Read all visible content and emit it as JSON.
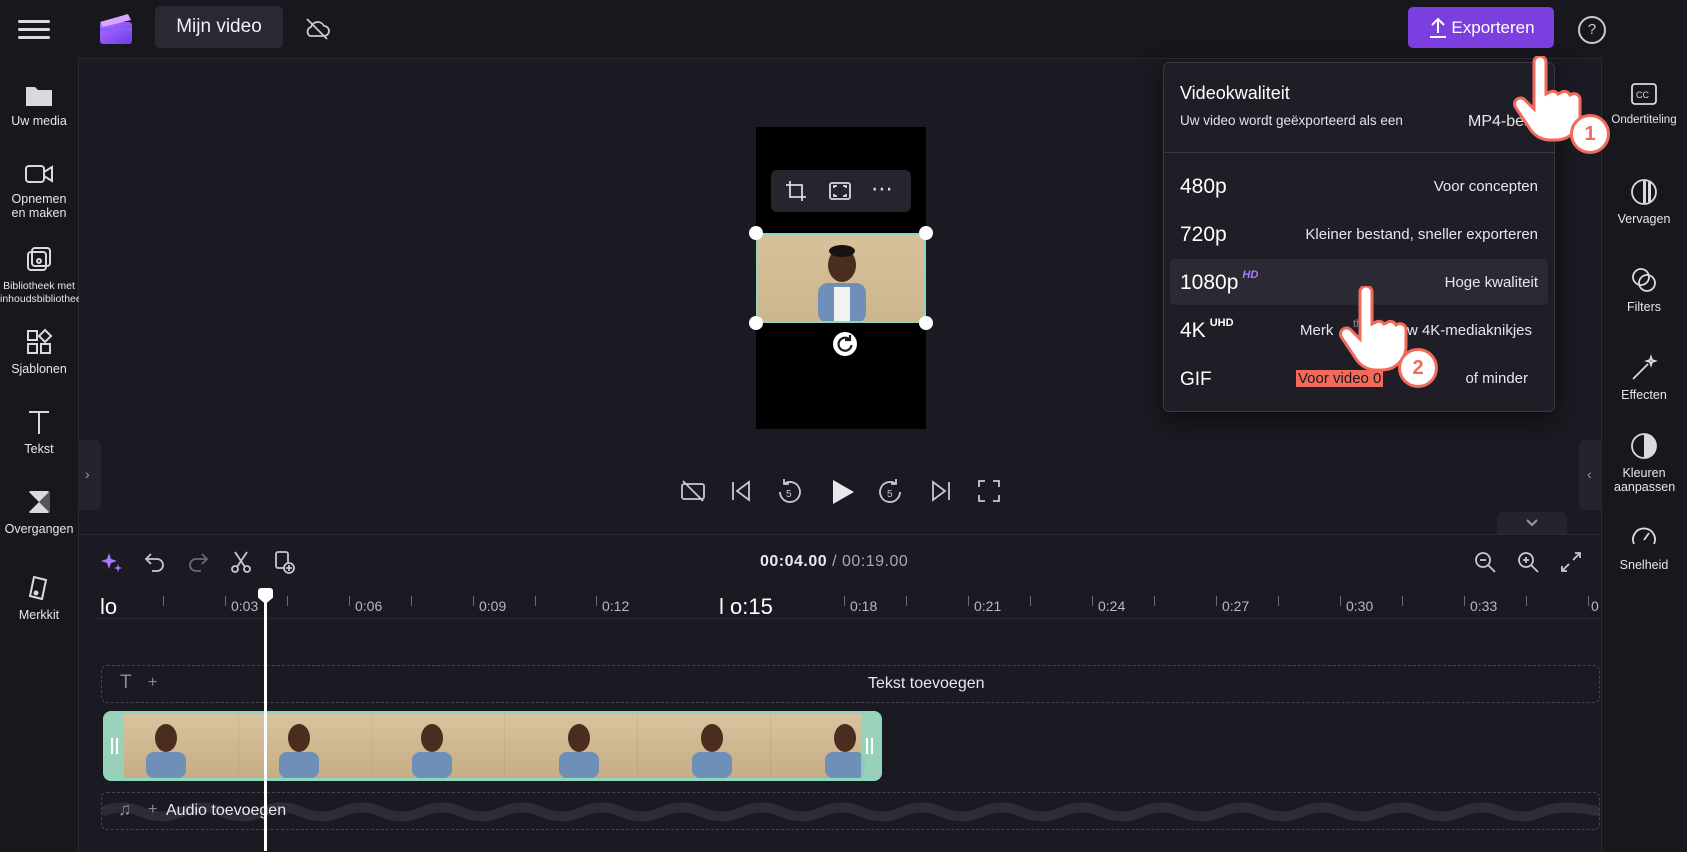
{
  "app": {
    "title": "Mijn video",
    "export_label": "Exporteren",
    "help_glyph": "?"
  },
  "left_sidebar": {
    "items": [
      {
        "label": "Uw media",
        "icon": "folder-icon"
      },
      {
        "label": "Opnemen en maken",
        "icon": "video-camera-icon"
      },
      {
        "label": "Bibliotheek met inhoudsbibliotheek",
        "icon": "library-icon"
      },
      {
        "label": "Sjablonen",
        "icon": "templates-icon"
      },
      {
        "label": "Tekst",
        "icon": "text-icon"
      },
      {
        "label": "Overgangen",
        "icon": "transitions-icon"
      },
      {
        "label": "Merkkit",
        "icon": "brand-kit-icon"
      }
    ]
  },
  "right_sidebar": {
    "items": [
      {
        "label": "Ondertiteling",
        "icon": "captions-icon"
      },
      {
        "label": "Vervagen",
        "icon": "fade-icon"
      },
      {
        "label": "Filters",
        "icon": "filters-icon"
      },
      {
        "label": "Effecten",
        "icon": "effects-icon"
      },
      {
        "label": "Kleuren aanpassen",
        "icon": "adjust-colors-icon"
      },
      {
        "label": "Snelheid",
        "icon": "speed-icon"
      }
    ]
  },
  "export_dropdown": {
    "title": "Videokwaliteit",
    "subtitle": "Uw video wordt geëxporteerd als een",
    "format": "MP4-bes",
    "options": [
      {
        "resolution": "480p",
        "badge": "",
        "description": "Voor concepten"
      },
      {
        "resolution": "720p",
        "badge": "",
        "description": "Kleiner bestand, sneller exporteren"
      },
      {
        "resolution": "1080p",
        "badge": "HD",
        "description": "Hoge kwaliteit"
      },
      {
        "resolution": "4K",
        "badge": "UHD",
        "description_part1": "Merk",
        "description_part2": "th",
        "description_part3": "t van uw 4K-mediaknikjes"
      },
      {
        "resolution": "GIF",
        "badge": "",
        "description_highlight": "Voor video 0",
        "description_rest": "of minder"
      }
    ]
  },
  "steps": {
    "one": "1",
    "two": "2"
  },
  "timeline": {
    "current_time": "00:04.00",
    "separator": " / ",
    "total_time": "00:19.00",
    "ruler_start": "lo",
    "ruler_marker": "l o:15",
    "ticks": [
      "0:03",
      "0:06",
      "0:09",
      "0:12",
      "0:18",
      "0:21",
      "0:24",
      "0:27",
      "0:30",
      "0:33",
      "0"
    ],
    "text_track_label": "Tekst toevoegen",
    "audio_track_label": "Audio toevoegen",
    "plus_glyph": "+"
  },
  "colors": {
    "accent": "#7b3fe0",
    "clip_border": "#8fd6bf",
    "step_badge": "#f26b5a"
  }
}
